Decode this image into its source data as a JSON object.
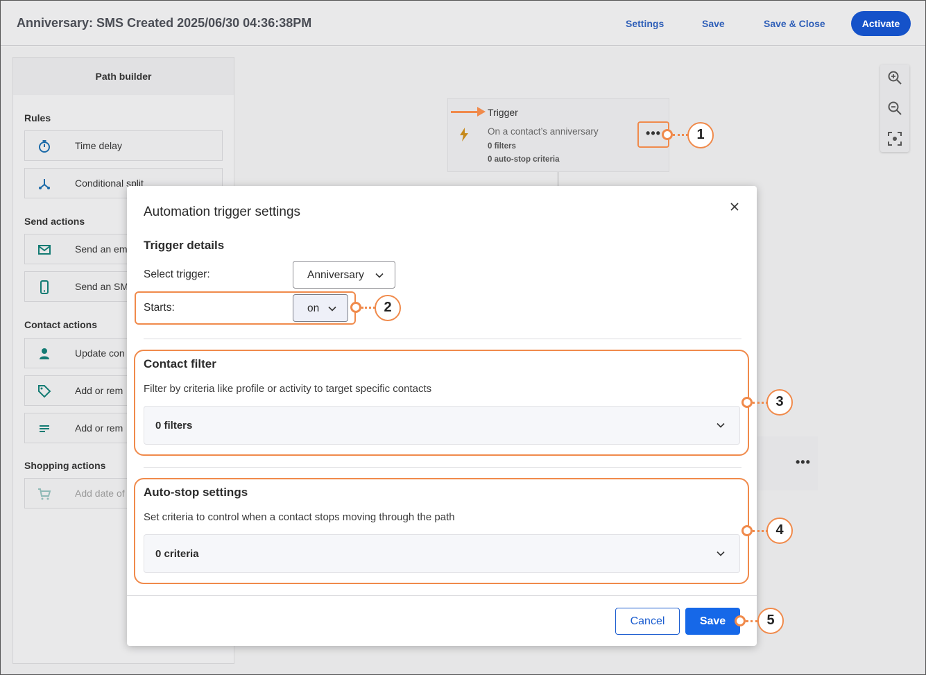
{
  "header": {
    "title": "Anniversary: SMS Created 2025/06/30 04:36:38PM",
    "settings_label": "Settings",
    "save_label": "Save",
    "save_close_label": "Save & Close",
    "activate_label": "Activate"
  },
  "panel": {
    "title": "Path builder",
    "sections": {
      "rules": "Rules",
      "send_actions": "Send actions",
      "contact_actions": "Contact actions",
      "shopping_actions": "Shopping actions"
    },
    "items": [
      {
        "label": "Time delay",
        "icon": "stopwatch-icon"
      },
      {
        "label": "Conditional split",
        "icon": "split-icon"
      },
      {
        "label": "Send an em",
        "icon": "envelope-icon"
      },
      {
        "label": "Send an SM",
        "icon": "phone-icon"
      },
      {
        "label": "Update con",
        "icon": "person-icon"
      },
      {
        "label": "Add or rem",
        "icon": "tag-icon"
      },
      {
        "label": "Add or rem",
        "icon": "list-icon"
      },
      {
        "label": "Add date of",
        "icon": "cart-icon"
      }
    ]
  },
  "trigger_node": {
    "title": "Trigger",
    "description": "On a contact’s anniversary",
    "filters": "0 filters",
    "auto_stop": "0 auto-stop criteria",
    "menu": "•••"
  },
  "second_node": {
    "menu": "•••"
  },
  "modal": {
    "title": "Automation trigger settings",
    "trigger_details_heading": "Trigger details",
    "select_trigger_label": "Select trigger:",
    "select_trigger_value": "Anniversary",
    "starts_label": "Starts:",
    "starts_value": "on",
    "contact_filter_heading": "Contact filter",
    "contact_filter_desc": "Filter by criteria like profile or activity to target specific contacts",
    "contact_filter_value": "0 filters",
    "auto_stop_heading": "Auto-stop settings",
    "auto_stop_desc": "Set criteria to control when a contact stops moving through the path",
    "auto_stop_value": "0 criteria",
    "cancel_label": "Cancel",
    "save_label": "Save"
  },
  "callouts": [
    "1",
    "2",
    "3",
    "4",
    "5"
  ],
  "colors": {
    "accent": "#f08a4b",
    "primary": "#1668e8",
    "activate": "#1552c9"
  }
}
